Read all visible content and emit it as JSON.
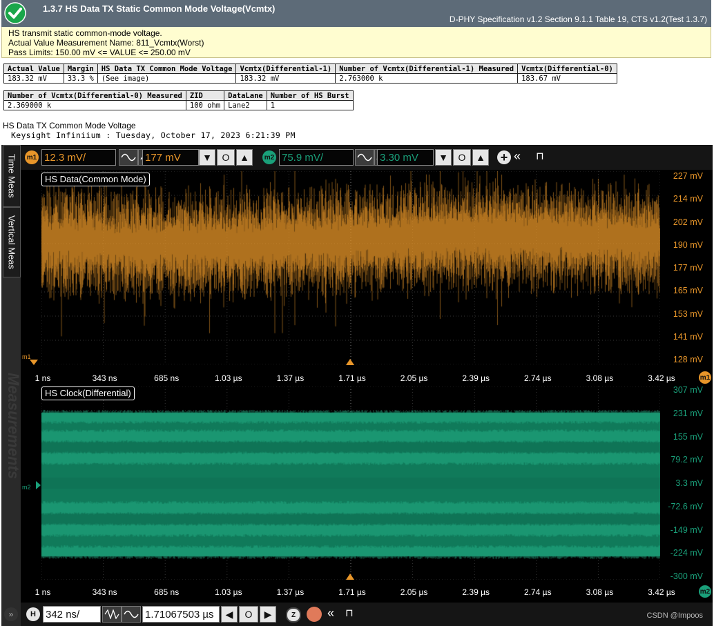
{
  "header": {
    "title": "1.3.7 HS Data TX Static Common Mode Voltage(Vcmtx)",
    "spec": "D-PHY Specification v1.2 Section 9.1.1 Table 19, CTS v1.2(Test 1.3.7)",
    "status_icon": "check-circle-icon",
    "status_color": "#1aa64a"
  },
  "description": {
    "line1": "HS transmit static common-mode voltage.",
    "line2": "Actual Value Measurement Name: 811_Vcmtx(Worst)",
    "line3": "Pass Limits: 150.00 mV <= VALUE <= 250.00 mV"
  },
  "results_table1": {
    "headers": [
      "Actual Value",
      "Margin",
      "HS Data TX Common Mode Voltage",
      "Vcmtx(Differential-1)",
      "Number of Vcmtx(Differential-1) Measured",
      "Vcmtx(Differential-0)"
    ],
    "row": [
      "183.32 mV",
      "33.3 %",
      "(See image)",
      "183.32 mV",
      "2.763000 k",
      "183.67 mV"
    ]
  },
  "results_table2": {
    "headers": [
      "Number of Vcmtx(Differential-0) Measured",
      "ZID",
      "DataLane",
      "Number of HS Burst"
    ],
    "row": [
      "2.369000 k",
      "100 ohm",
      "Lane2",
      "1"
    ]
  },
  "image_title": "HS Data TX Common Mode Voltage",
  "scope_signature": "Keysight Infiniium : Tuesday, October 17, 2023 6:21:39 PM",
  "scope": {
    "side_tabs": [
      "Time Meas",
      "Vertical Meas"
    ],
    "measurements_tab": "Measurements",
    "m1": {
      "badge": "m1",
      "scale": "12.3 mV/",
      "offset": "177 mV",
      "color": "#e8962a"
    },
    "m2": {
      "badge": "m2",
      "scale": "75.9 mV/",
      "offset": "3.30 mV",
      "color": "#1aa07a"
    },
    "plot1": {
      "title": "HS Data(Common Mode)",
      "y_labels": [
        "227 mV",
        "214 mV",
        "202 mV",
        "190 mV",
        "177 mV",
        "165 mV",
        "153 mV",
        "141 mV",
        "128 mV"
      ],
      "x_labels": [
        "1 ns",
        "343 ns",
        "685 ns",
        "1.03 µs",
        "1.37 µs",
        "1.71 µs",
        "2.05 µs",
        "2.39 µs",
        "2.74 µs",
        "3.08 µs",
        "3.42 µs"
      ],
      "marker": "m1"
    },
    "plot2": {
      "title": "HS Clock(Differential)",
      "y_labels": [
        "307 mV",
        "231 mV",
        "155 mV",
        "79.2 mV",
        "3.3 mV",
        "-72.6 mV",
        "-149 mV",
        "-224 mV",
        "-300 mV"
      ],
      "x_labels": [
        "1 ns",
        "343 ns",
        "685 ns",
        "1.03 µs",
        "1.37 µs",
        "1.71 µs",
        "2.05 µs",
        "2.39 µs",
        "2.74 µs",
        "3.08 µs",
        "3.42 µs"
      ],
      "marker": "m2"
    },
    "horizontal": {
      "badge": "H",
      "scale": "342 ns/",
      "position": "1.71067503 µs",
      "zoom_badge": "Z"
    },
    "watermark": "CSDN @Impoos"
  }
}
